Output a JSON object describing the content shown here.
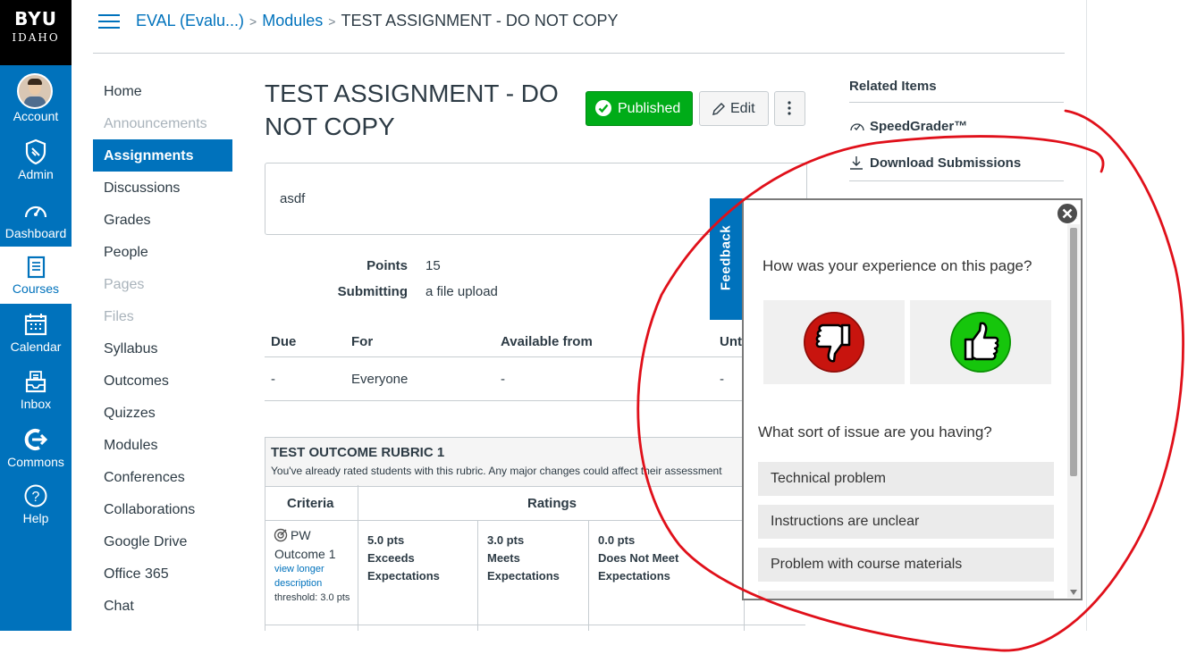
{
  "brand": {
    "line1": "BYU",
    "line2": "IDAHO"
  },
  "global_nav": [
    {
      "id": "account",
      "label": "Account",
      "icon": "avatar"
    },
    {
      "id": "admin",
      "label": "Admin",
      "icon": "shield-icon"
    },
    {
      "id": "dashboard",
      "label": "Dashboard",
      "icon": "speedometer-icon"
    },
    {
      "id": "courses",
      "label": "Courses",
      "icon": "book-icon",
      "active": true
    },
    {
      "id": "calendar",
      "label": "Calendar",
      "icon": "calendar-icon"
    },
    {
      "id": "inbox",
      "label": "Inbox",
      "icon": "inbox-icon"
    },
    {
      "id": "commons",
      "label": "Commons",
      "icon": "commons-icon"
    },
    {
      "id": "help",
      "label": "Help",
      "icon": "help-icon"
    }
  ],
  "breadcrumb": {
    "course": "EVAL (Evalu...)",
    "section": "Modules",
    "current": "TEST ASSIGNMENT - DO NOT COPY"
  },
  "course_nav": [
    {
      "label": "Home",
      "disabled": false
    },
    {
      "label": "Announcements",
      "disabled": true
    },
    {
      "label": "Assignments",
      "active": true
    },
    {
      "label": "Discussions"
    },
    {
      "label": "Grades"
    },
    {
      "label": "People"
    },
    {
      "label": "Pages",
      "disabled": true
    },
    {
      "label": "Files",
      "disabled": true
    },
    {
      "label": "Syllabus"
    },
    {
      "label": "Outcomes"
    },
    {
      "label": "Quizzes"
    },
    {
      "label": "Modules"
    },
    {
      "label": "Conferences"
    },
    {
      "label": "Collaborations"
    },
    {
      "label": "Google Drive"
    },
    {
      "label": "Office 365"
    },
    {
      "label": "Chat"
    }
  ],
  "assignment": {
    "title": "TEST ASSIGNMENT - DO NOT COPY",
    "published_label": "Published",
    "edit_label": "Edit",
    "description": "asdf",
    "points_label": "Points",
    "points_value": "15",
    "submitting_label": "Submitting",
    "submitting_value": "a file upload"
  },
  "dates_table": {
    "headers": [
      "Due",
      "For",
      "Available from",
      "Unt"
    ],
    "row": [
      "-",
      "Everyone",
      "-",
      "-"
    ]
  },
  "rubric": {
    "title": "TEST OUTCOME RUBRIC 1",
    "warning": "You've already rated students with this rubric. Any major changes could affect their assessment",
    "criteria_header": "Criteria",
    "ratings_header": "Ratings",
    "criterion": {
      "name": "PW",
      "outcome": "Outcome 1",
      "link1": "view longer",
      "link2": "description",
      "threshold": "threshold: 3.0 pts"
    },
    "ratings": [
      {
        "pts": "5.0 pts",
        "l1": "Exceeds",
        "l2": "Expectations"
      },
      {
        "pts": "3.0 pts",
        "l1": "Meets",
        "l2": "Expectations"
      },
      {
        "pts": "0.0 pts",
        "l1": "Does Not Meet",
        "l2": "Expectations"
      }
    ]
  },
  "related": {
    "title": "Related Items",
    "speedgrader": "SpeedGrader™",
    "download": "Download Submissions"
  },
  "feedback": {
    "tab_label": "Feedback",
    "question1": "How was your experience on this page?",
    "question2": "What sort of issue are you having?",
    "options": [
      "Technical problem",
      "Instructions are unclear",
      "Problem with course materials"
    ]
  },
  "colors": {
    "nav_blue": "#0072bc",
    "published_green": "#00ac18",
    "annotation_red": "#e0101a",
    "thumb_down": "#c8140e",
    "thumb_up": "#16c60c"
  }
}
